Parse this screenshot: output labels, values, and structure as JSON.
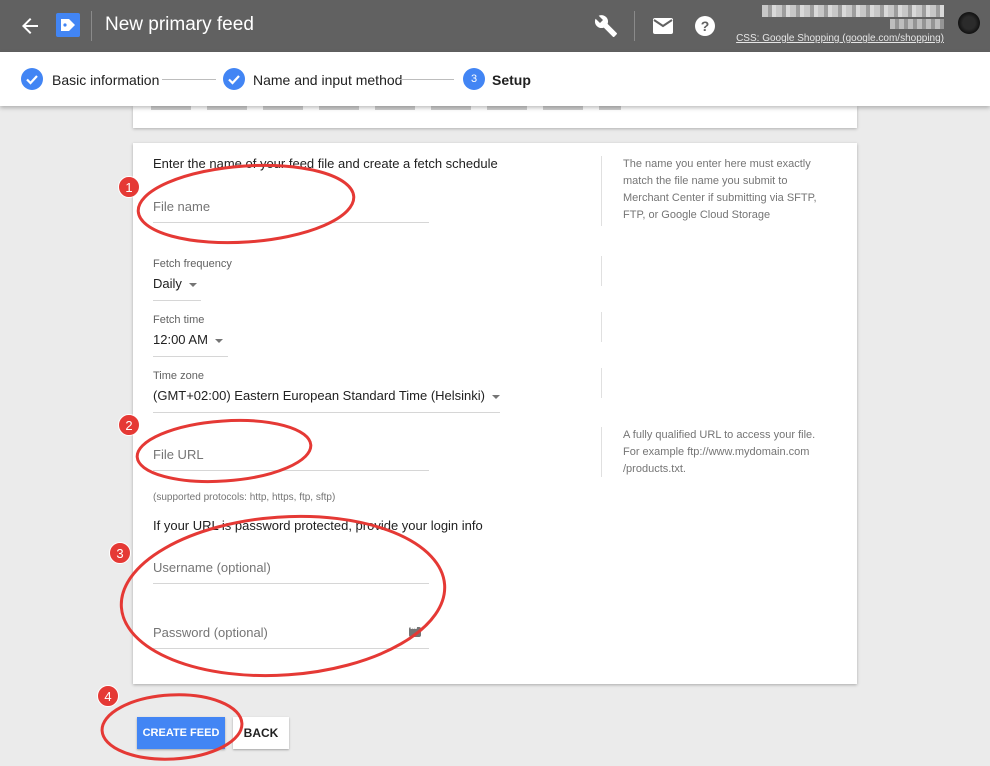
{
  "topbar": {
    "title": "New primary feed",
    "css_link": "CSS: Google Shopping (google.com/shopping)",
    "icons": [
      "back-arrow-icon",
      "tag-icon",
      "wrench-icon",
      "mail-icon",
      "help-icon",
      "avatar"
    ]
  },
  "stepper": {
    "steps": [
      {
        "label": "Basic information",
        "state": "done"
      },
      {
        "label": "Name and input method",
        "state": "done"
      },
      {
        "label": "Setup",
        "state": "active",
        "number": "3"
      }
    ]
  },
  "form": {
    "section_title": "Enter the name of your feed file and create a fetch schedule",
    "file_name": {
      "placeholder": "File name",
      "value": ""
    },
    "file_name_help": "The name you enter here must exactly match the file name you submit to Merchant Center if submitting via SFTP, FTP, or Google Cloud Storage",
    "fetch_frequency": {
      "label": "Fetch frequency",
      "value": "Daily"
    },
    "fetch_time": {
      "label": "Fetch time",
      "value": "12:00 AM"
    },
    "time_zone": {
      "label": "Time zone",
      "value": "(GMT+02:00) Eastern European Standard Time (Helsinki)"
    },
    "file_url": {
      "placeholder": "File URL",
      "value": ""
    },
    "file_url_help": "A fully qualified URL to access your file. For example ftp://www.mydomain.com /products.txt.",
    "protocols_hint": "(supported protocols: http, https, ftp, sftp)",
    "login_title": "If your URL is password protected, provide your login info",
    "username": {
      "placeholder": "Username (optional)",
      "value": ""
    },
    "password": {
      "placeholder": "Password (optional)",
      "value": ""
    }
  },
  "buttons": {
    "create": "CREATE FEED",
    "back": "BACK"
  },
  "annotations": {
    "badges": [
      "1",
      "2",
      "3",
      "4"
    ],
    "color": "#e53935"
  },
  "colors": {
    "topbar": "#616161",
    "accent": "#4285f4"
  }
}
